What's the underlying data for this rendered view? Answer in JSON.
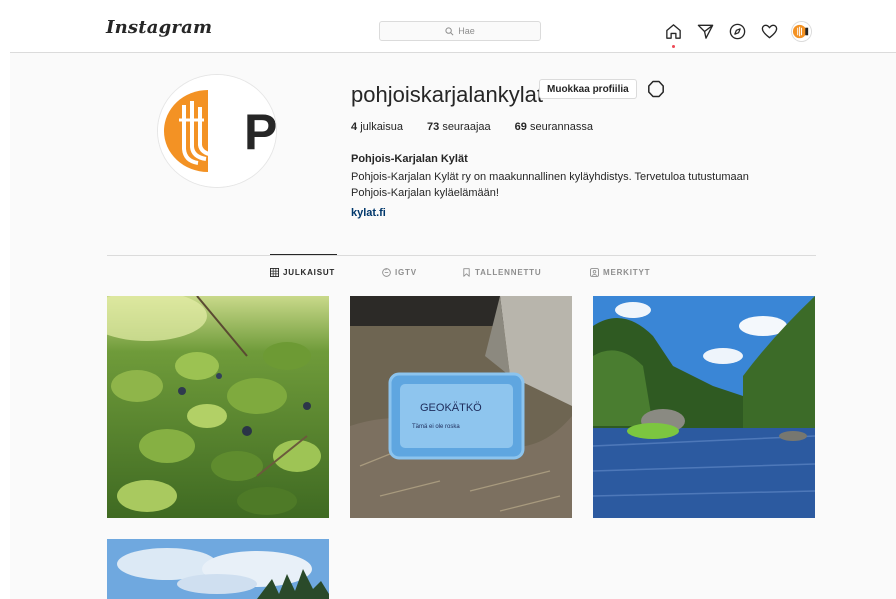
{
  "nav": {
    "logo": "Instagram",
    "search_placeholder": "Hae",
    "icons": [
      "home-icon",
      "direct-icon",
      "explore-icon",
      "activity-icon",
      "profile-avatar"
    ]
  },
  "profile": {
    "username": "pohjoiskarjalankylat",
    "edit_button": "Muokkaa profiilia",
    "stats": [
      {
        "count": "4",
        "label": "julkaisua"
      },
      {
        "count": "73",
        "label": "seuraajaa"
      },
      {
        "count": "69",
        "label": "seurannassa"
      }
    ],
    "full_name": "Pohjois-Karjalan Kylät",
    "bio_line1": "Pohjois-Karjalan Kylät ry on maakunnallinen kyläyhdistys. Tervetuloa tutustumaan",
    "bio_line2": "Pohjois-Karjalan kyläelämään!",
    "link": "kylat.fi",
    "avatar_letter": "P"
  },
  "tabs": [
    {
      "label": "JULKAISUT",
      "icon": "grid-icon",
      "active": true
    },
    {
      "label": "IGTV",
      "icon": "igtv-icon",
      "active": false
    },
    {
      "label": "TALLENNETTU",
      "icon": "bookmark-icon",
      "active": false
    },
    {
      "label": "MERKITYT",
      "icon": "tagged-icon",
      "active": false
    }
  ],
  "posts": {
    "post3_box_title": "GEOKÄTKÖ",
    "post3_box_note": "Tämä ei ole roska"
  },
  "colors": {
    "brand_orange": "#f39224",
    "link_blue": "#00376b",
    "notification_red": "#ed4956"
  }
}
